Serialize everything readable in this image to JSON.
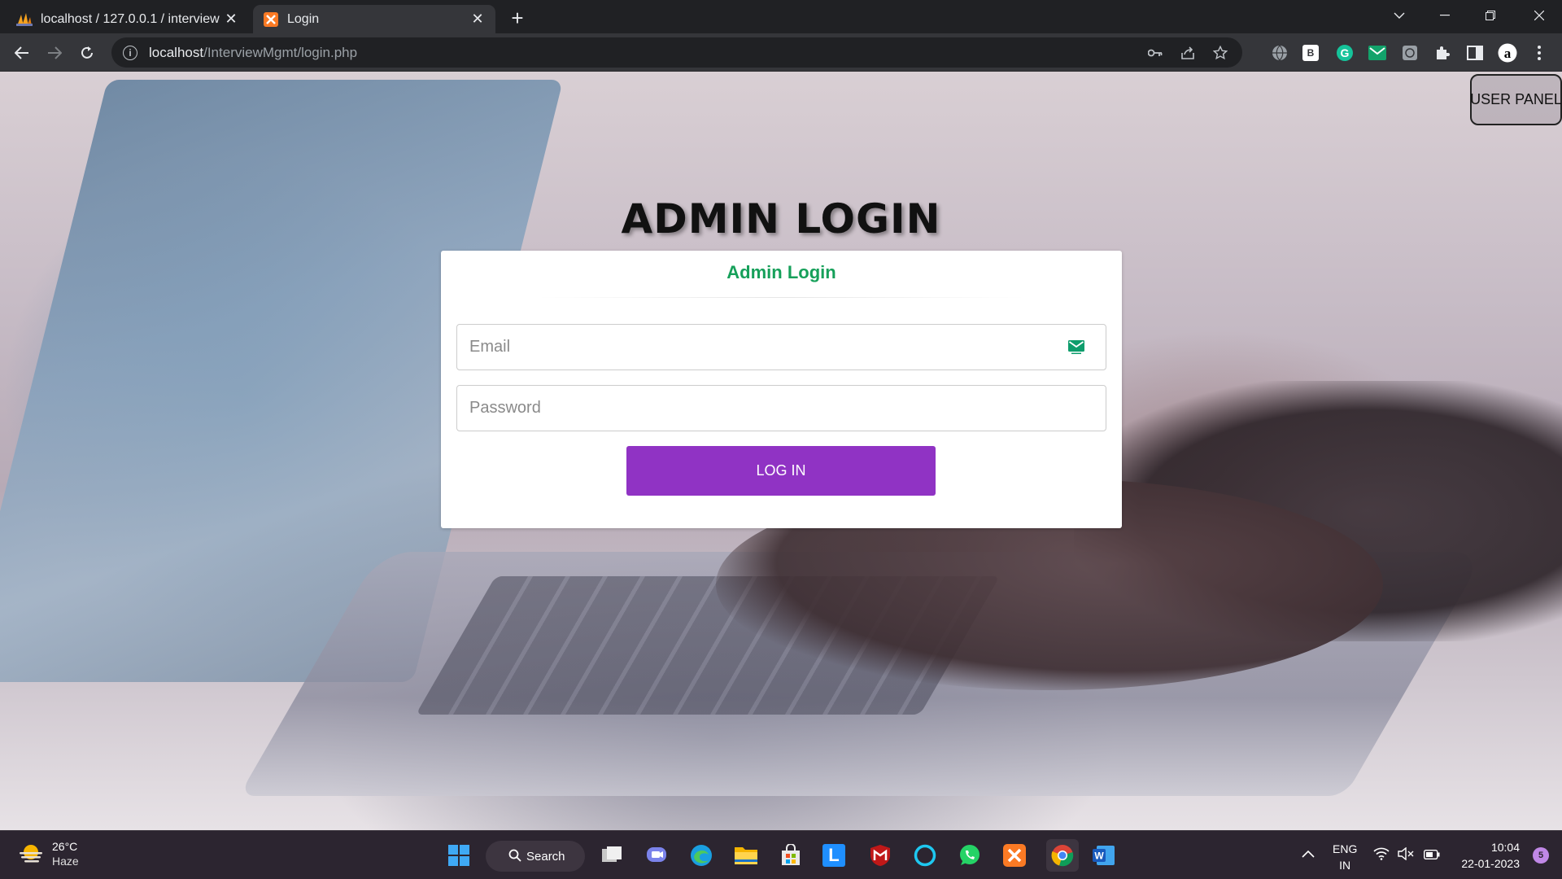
{
  "browser": {
    "tabs": [
      {
        "title": "localhost / 127.0.0.1 / interview |",
        "active": false
      },
      {
        "title": "Login",
        "active": true
      }
    ],
    "url_host": "localhost",
    "url_path": "/InterviewMgmt/login.php",
    "extensions": [
      "globe-icon",
      "b-extension-icon",
      "grammarly-icon",
      "mail-extension-icon",
      "extension-grid-icon",
      "puzzle-icon",
      "sidepanel-icon",
      "profile-avatar-icon",
      "more-menu-icon"
    ]
  },
  "page": {
    "user_panel_label": "USER PANEL",
    "heading": "ADMIN LOGIN",
    "card_title": "Admin Login",
    "email_placeholder": "Email",
    "password_placeholder": "Password",
    "login_button": "LOG IN",
    "accent_color": "#9033c4",
    "title_color": "#16a05a"
  },
  "taskbar": {
    "weather_temp": "26°C",
    "weather_cond": "Haze",
    "search_label": "Search",
    "lang_line1": "ENG",
    "lang_line2": "IN",
    "time": "10:04",
    "date": "22-01-2023",
    "notification_count": "5"
  }
}
